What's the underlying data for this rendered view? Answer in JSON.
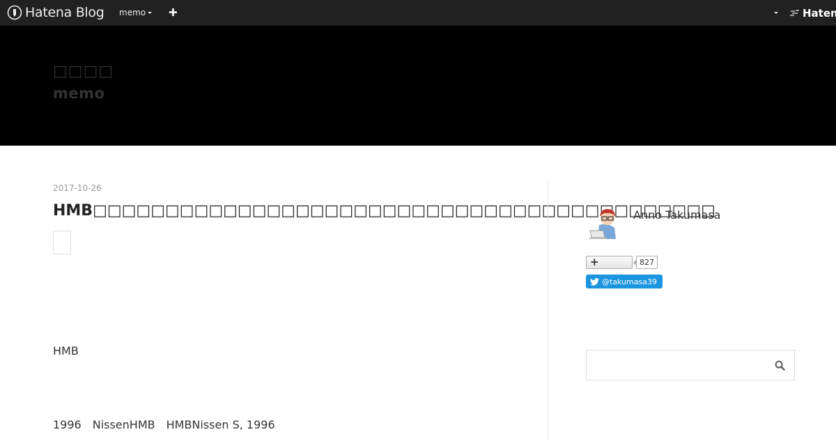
{
  "navbar": {
    "logo_text": "Hatena Blog",
    "blog_menu_label": "memo",
    "add_label": "✚",
    "hatena_label": "Hatena",
    "logo_icon": "hatena-blog-pen-icon"
  },
  "header": {
    "blog_title": "□□□□",
    "blog_subtitle": "memo"
  },
  "entry": {
    "date": "2017-10-26",
    "title": "HMB□□□□□□□□□□□□□□□□□□□□□□□□□□□□□□□□□□□□□□□□□□□",
    "paragraphs": [
      "HMB",
      "1996　NissenHMB　HMBNissen S, 1996"
    ]
  },
  "sidebar": {
    "author_name": "Anno Takumasa",
    "follow_count": "827",
    "twitter_handle": "@takumasa39",
    "search_placeholder": ""
  },
  "colors": {
    "navbar_bg": "#212121",
    "header_bg": "#000000",
    "twitter_blue": "#1b95e0"
  }
}
